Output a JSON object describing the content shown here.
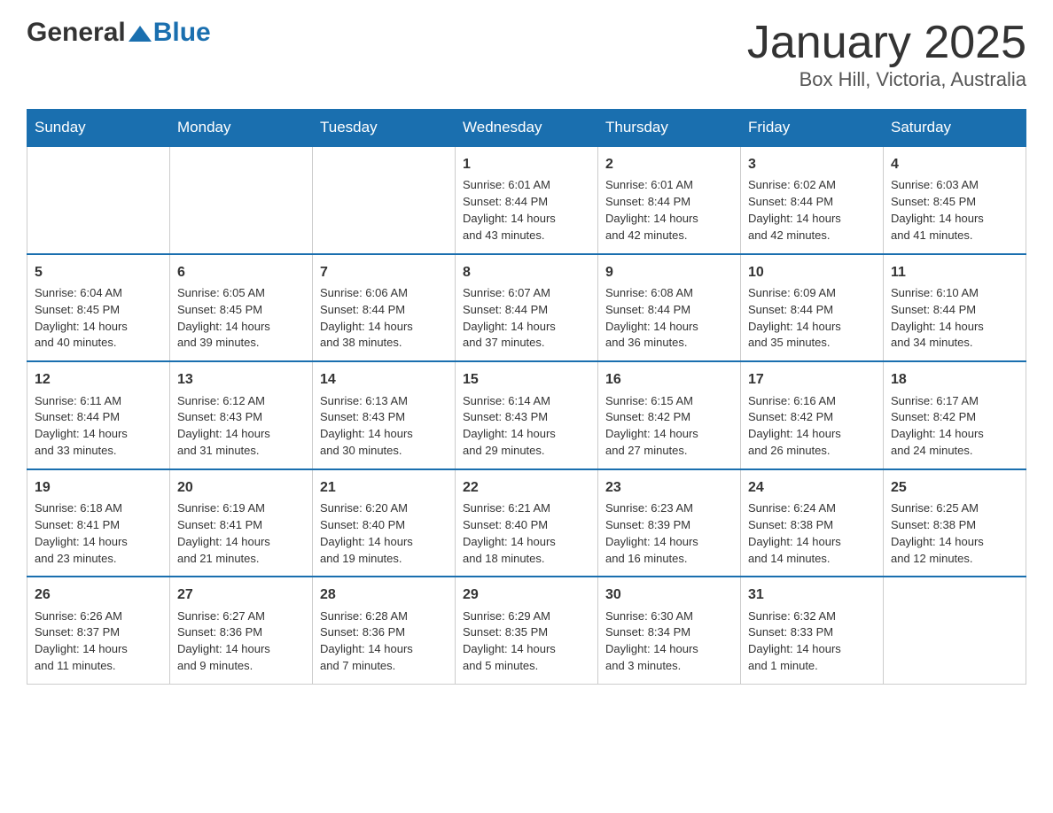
{
  "header": {
    "logo_general": "General",
    "logo_blue": "Blue",
    "month_title": "January 2025",
    "location": "Box Hill, Victoria, Australia"
  },
  "days_of_week": [
    "Sunday",
    "Monday",
    "Tuesday",
    "Wednesday",
    "Thursday",
    "Friday",
    "Saturday"
  ],
  "weeks": [
    [
      {
        "day": "",
        "info": ""
      },
      {
        "day": "",
        "info": ""
      },
      {
        "day": "",
        "info": ""
      },
      {
        "day": "1",
        "info": "Sunrise: 6:01 AM\nSunset: 8:44 PM\nDaylight: 14 hours\nand 43 minutes."
      },
      {
        "day": "2",
        "info": "Sunrise: 6:01 AM\nSunset: 8:44 PM\nDaylight: 14 hours\nand 42 minutes."
      },
      {
        "day": "3",
        "info": "Sunrise: 6:02 AM\nSunset: 8:44 PM\nDaylight: 14 hours\nand 42 minutes."
      },
      {
        "day": "4",
        "info": "Sunrise: 6:03 AM\nSunset: 8:45 PM\nDaylight: 14 hours\nand 41 minutes."
      }
    ],
    [
      {
        "day": "5",
        "info": "Sunrise: 6:04 AM\nSunset: 8:45 PM\nDaylight: 14 hours\nand 40 minutes."
      },
      {
        "day": "6",
        "info": "Sunrise: 6:05 AM\nSunset: 8:45 PM\nDaylight: 14 hours\nand 39 minutes."
      },
      {
        "day": "7",
        "info": "Sunrise: 6:06 AM\nSunset: 8:44 PM\nDaylight: 14 hours\nand 38 minutes."
      },
      {
        "day": "8",
        "info": "Sunrise: 6:07 AM\nSunset: 8:44 PM\nDaylight: 14 hours\nand 37 minutes."
      },
      {
        "day": "9",
        "info": "Sunrise: 6:08 AM\nSunset: 8:44 PM\nDaylight: 14 hours\nand 36 minutes."
      },
      {
        "day": "10",
        "info": "Sunrise: 6:09 AM\nSunset: 8:44 PM\nDaylight: 14 hours\nand 35 minutes."
      },
      {
        "day": "11",
        "info": "Sunrise: 6:10 AM\nSunset: 8:44 PM\nDaylight: 14 hours\nand 34 minutes."
      }
    ],
    [
      {
        "day": "12",
        "info": "Sunrise: 6:11 AM\nSunset: 8:44 PM\nDaylight: 14 hours\nand 33 minutes."
      },
      {
        "day": "13",
        "info": "Sunrise: 6:12 AM\nSunset: 8:43 PM\nDaylight: 14 hours\nand 31 minutes."
      },
      {
        "day": "14",
        "info": "Sunrise: 6:13 AM\nSunset: 8:43 PM\nDaylight: 14 hours\nand 30 minutes."
      },
      {
        "day": "15",
        "info": "Sunrise: 6:14 AM\nSunset: 8:43 PM\nDaylight: 14 hours\nand 29 minutes."
      },
      {
        "day": "16",
        "info": "Sunrise: 6:15 AM\nSunset: 8:42 PM\nDaylight: 14 hours\nand 27 minutes."
      },
      {
        "day": "17",
        "info": "Sunrise: 6:16 AM\nSunset: 8:42 PM\nDaylight: 14 hours\nand 26 minutes."
      },
      {
        "day": "18",
        "info": "Sunrise: 6:17 AM\nSunset: 8:42 PM\nDaylight: 14 hours\nand 24 minutes."
      }
    ],
    [
      {
        "day": "19",
        "info": "Sunrise: 6:18 AM\nSunset: 8:41 PM\nDaylight: 14 hours\nand 23 minutes."
      },
      {
        "day": "20",
        "info": "Sunrise: 6:19 AM\nSunset: 8:41 PM\nDaylight: 14 hours\nand 21 minutes."
      },
      {
        "day": "21",
        "info": "Sunrise: 6:20 AM\nSunset: 8:40 PM\nDaylight: 14 hours\nand 19 minutes."
      },
      {
        "day": "22",
        "info": "Sunrise: 6:21 AM\nSunset: 8:40 PM\nDaylight: 14 hours\nand 18 minutes."
      },
      {
        "day": "23",
        "info": "Sunrise: 6:23 AM\nSunset: 8:39 PM\nDaylight: 14 hours\nand 16 minutes."
      },
      {
        "day": "24",
        "info": "Sunrise: 6:24 AM\nSunset: 8:38 PM\nDaylight: 14 hours\nand 14 minutes."
      },
      {
        "day": "25",
        "info": "Sunrise: 6:25 AM\nSunset: 8:38 PM\nDaylight: 14 hours\nand 12 minutes."
      }
    ],
    [
      {
        "day": "26",
        "info": "Sunrise: 6:26 AM\nSunset: 8:37 PM\nDaylight: 14 hours\nand 11 minutes."
      },
      {
        "day": "27",
        "info": "Sunrise: 6:27 AM\nSunset: 8:36 PM\nDaylight: 14 hours\nand 9 minutes."
      },
      {
        "day": "28",
        "info": "Sunrise: 6:28 AM\nSunset: 8:36 PM\nDaylight: 14 hours\nand 7 minutes."
      },
      {
        "day": "29",
        "info": "Sunrise: 6:29 AM\nSunset: 8:35 PM\nDaylight: 14 hours\nand 5 minutes."
      },
      {
        "day": "30",
        "info": "Sunrise: 6:30 AM\nSunset: 8:34 PM\nDaylight: 14 hours\nand 3 minutes."
      },
      {
        "day": "31",
        "info": "Sunrise: 6:32 AM\nSunset: 8:33 PM\nDaylight: 14 hours\nand 1 minute."
      },
      {
        "day": "",
        "info": ""
      }
    ]
  ]
}
